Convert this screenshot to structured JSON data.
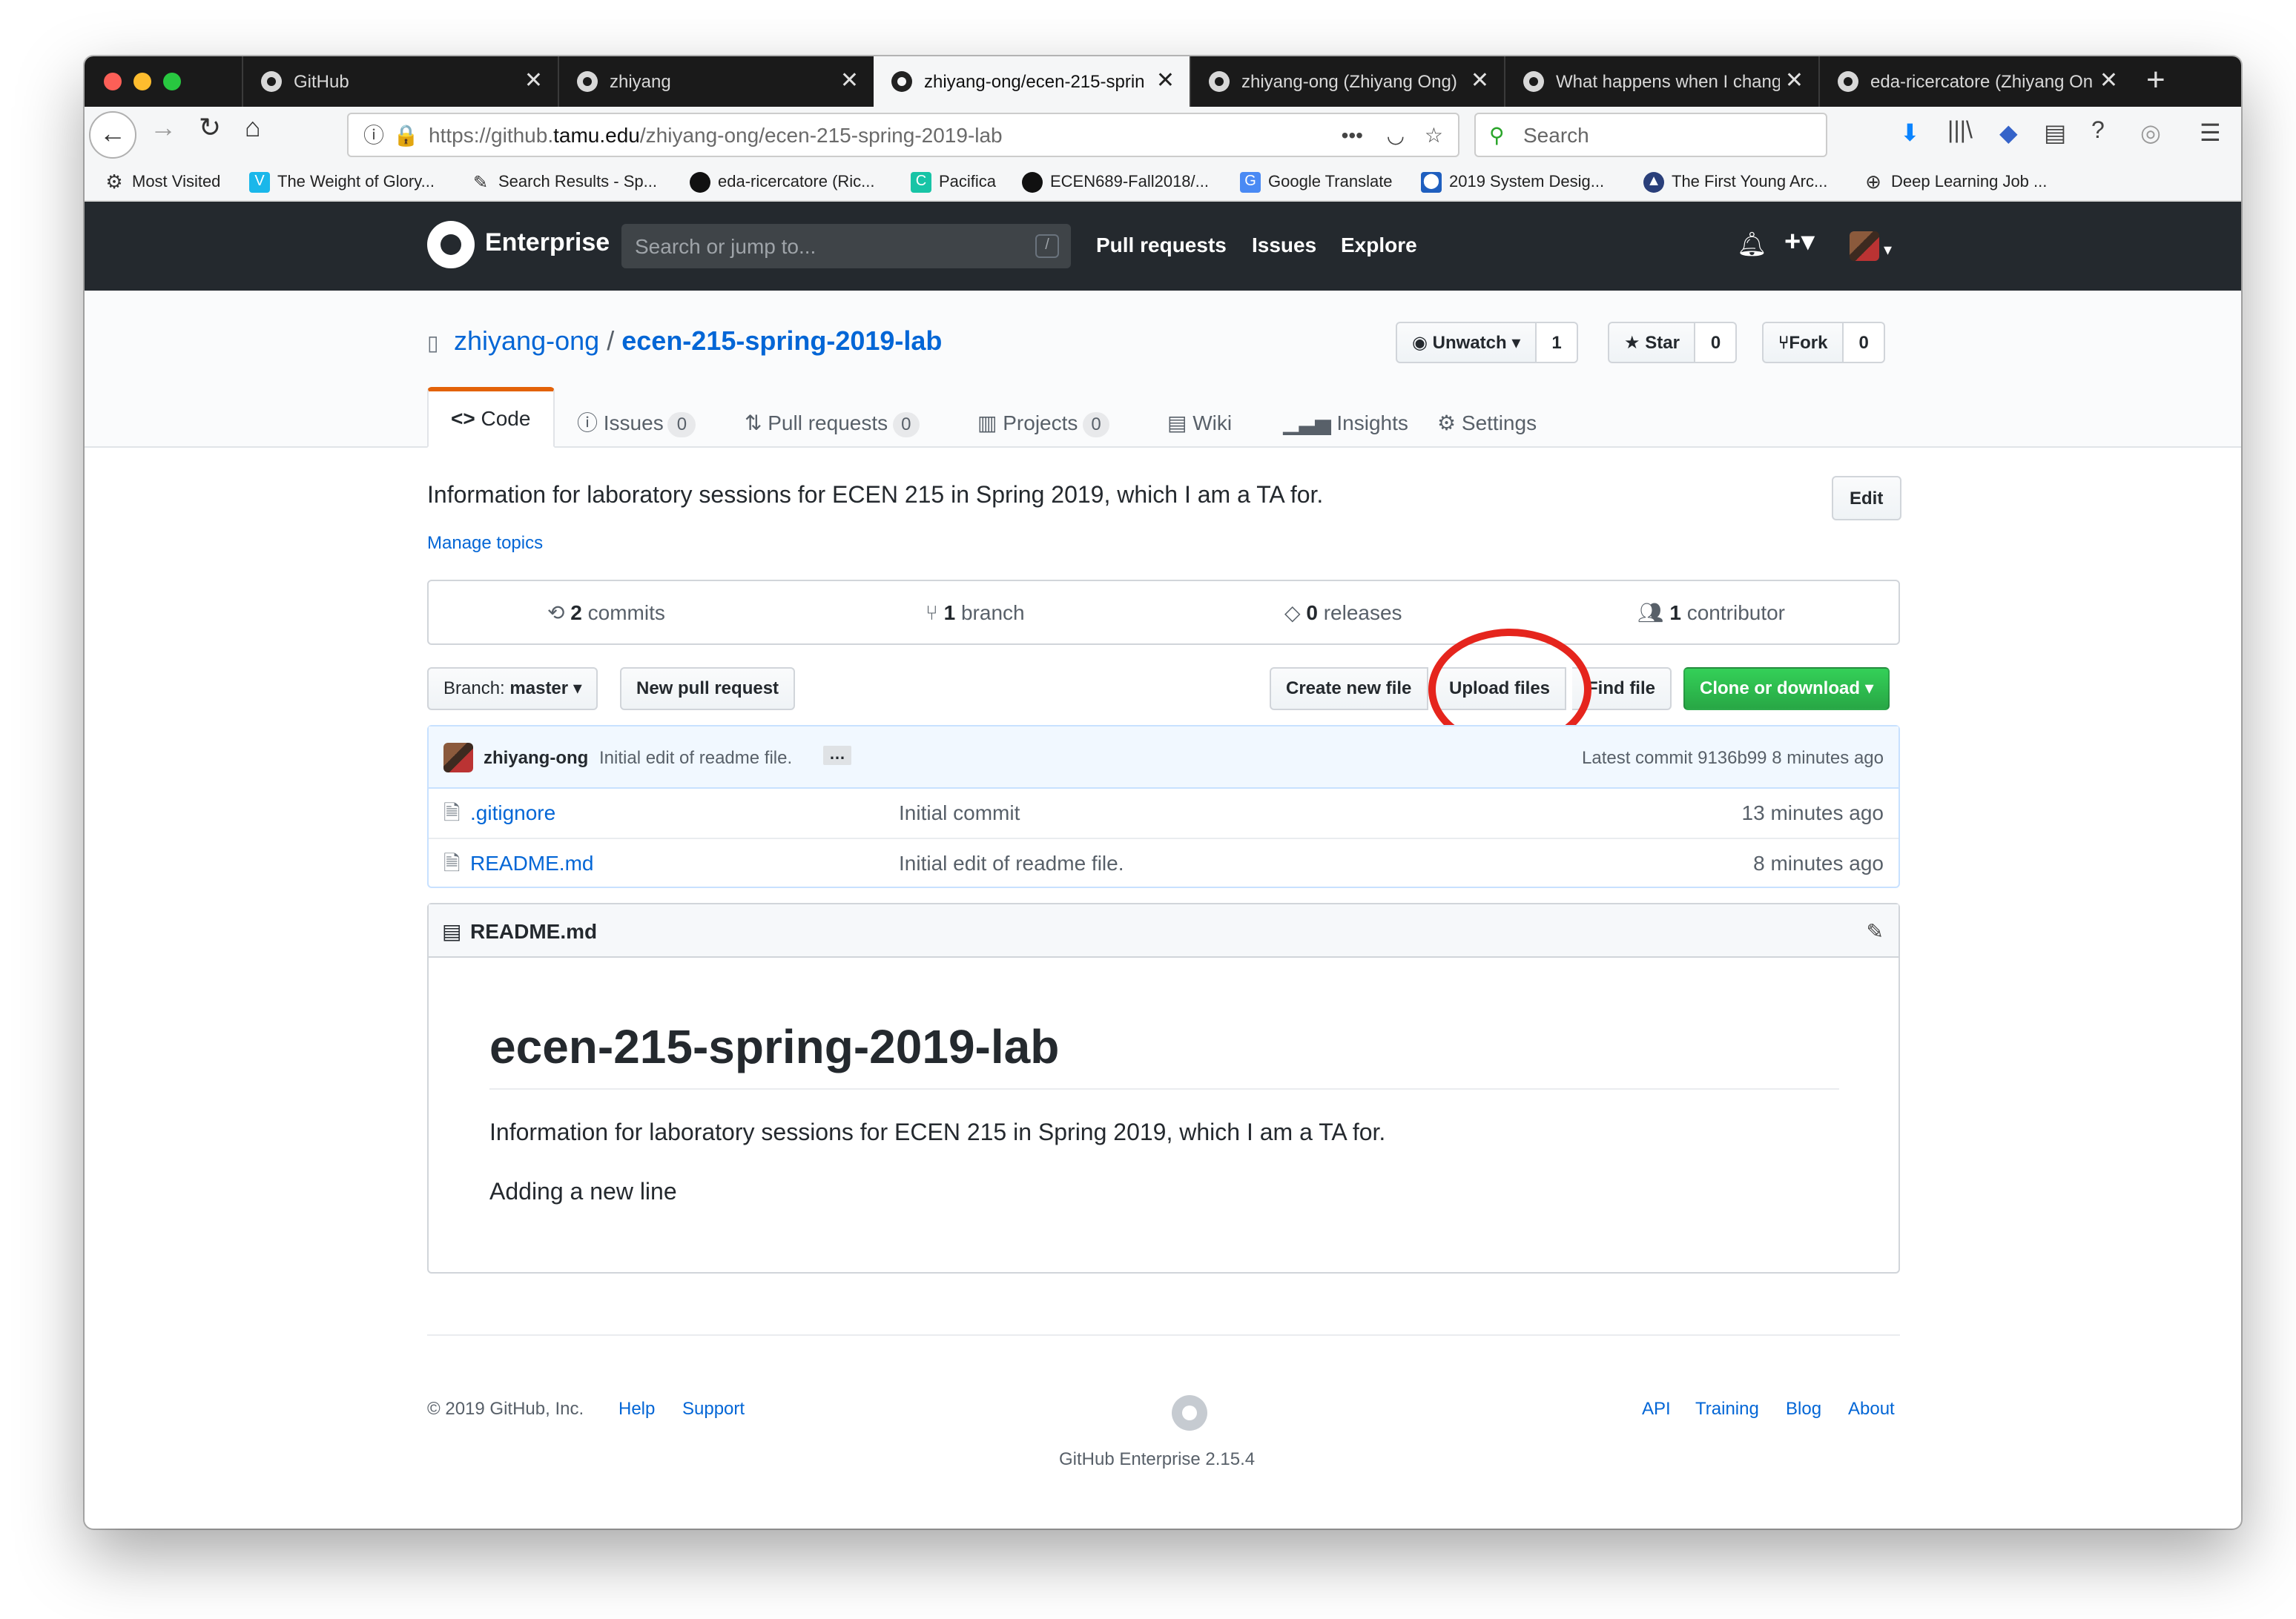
{
  "browser": {
    "tabs": [
      {
        "title": "GitHub",
        "active": false
      },
      {
        "title": "zhiyang",
        "active": false
      },
      {
        "title": "zhiyang-ong/ecen-215-sprin",
        "active": true
      },
      {
        "title": "zhiyang-ong (Zhiyang Ong)",
        "active": false
      },
      {
        "title": "What happens when I chang",
        "active": false
      },
      {
        "title": "eda-ricercatore (Zhiyang On",
        "active": false
      }
    ],
    "url_prefix": "https://github.",
    "url_domain": "tamu.edu",
    "url_path": "/zhiyang-ong/ecen-215-spring-2019-lab",
    "search_placeholder": "Search",
    "bookmarks": [
      "Most Visited",
      "The Weight of Glory...",
      "Search Results - Sp...",
      "eda-ricercatore (Ric...",
      "Pacifica",
      "ECEN689-Fall2018/...",
      "Google Translate",
      "2019 System Desig...",
      "The First Young Arc...",
      "Deep Learning Job ..."
    ]
  },
  "github": {
    "brand": "Enterprise",
    "search_placeholder": "Search or jump to...",
    "slash": "/",
    "nav": [
      "Pull requests",
      "Issues",
      "Explore"
    ]
  },
  "repo": {
    "owner": "zhiyang-ong",
    "separator": "/",
    "name": "ecen-215-spring-2019-lab",
    "watch_label": "Unwatch",
    "watch_count": "1",
    "star_label": "Star",
    "star_count": "0",
    "fork_label": "Fork",
    "fork_count": "0",
    "tabs": [
      {
        "label": "Code"
      },
      {
        "label": "Issues",
        "count": "0"
      },
      {
        "label": "Pull requests",
        "count": "0"
      },
      {
        "label": "Projects",
        "count": "0"
      },
      {
        "label": "Wiki"
      },
      {
        "label": "Insights"
      },
      {
        "label": "Settings"
      }
    ],
    "description": "Information for laboratory sessions for ECEN 215 in Spring 2019, which I am a TA for.",
    "edit_label": "Edit",
    "manage_topics": "Manage topics",
    "summary": {
      "commits_num": "2",
      "commits_label": "commits",
      "branch_num": "1",
      "branch_label": "branch",
      "releases_num": "0",
      "releases_label": "releases",
      "contributor_num": "1",
      "contributor_label": "contributor"
    },
    "branch_prefix": "Branch:",
    "branch_name": "master",
    "new_pr": "New pull request",
    "create_file": "Create new file",
    "upload_files": "Upload files",
    "find_file": "Find file",
    "clone": "Clone or download",
    "commit": {
      "author": "zhiyang-ong",
      "message": "Initial edit of readme file.",
      "ellipsis": "…",
      "latest_label": "Latest commit",
      "sha": "9136b99",
      "time": "8 minutes ago"
    },
    "files": [
      {
        "name": ".gitignore",
        "message": "Initial commit",
        "time": "13 minutes ago"
      },
      {
        "name": "README.md",
        "message": "Initial edit of readme file.",
        "time": "8 minutes ago"
      }
    ],
    "readme": {
      "filename": "README.md",
      "heading": "ecen-215-spring-2019-lab",
      "paragraph1": "Information for laboratory sessions for ECEN 215 in Spring 2019, which I am a TA for.",
      "paragraph2": "Adding a new line"
    }
  },
  "footer": {
    "copyright": "© 2019 GitHub, Inc.",
    "left_links": [
      "Help",
      "Support"
    ],
    "version": "GitHub Enterprise 2.15.4",
    "right_links": [
      "API",
      "Training",
      "Blog",
      "About"
    ]
  },
  "colors": {
    "highlight_circle": "#e5251d",
    "accent_tab": "#e36209",
    "link": "#0366d6",
    "green_button": "#28a745",
    "header_bg": "#24292e"
  }
}
